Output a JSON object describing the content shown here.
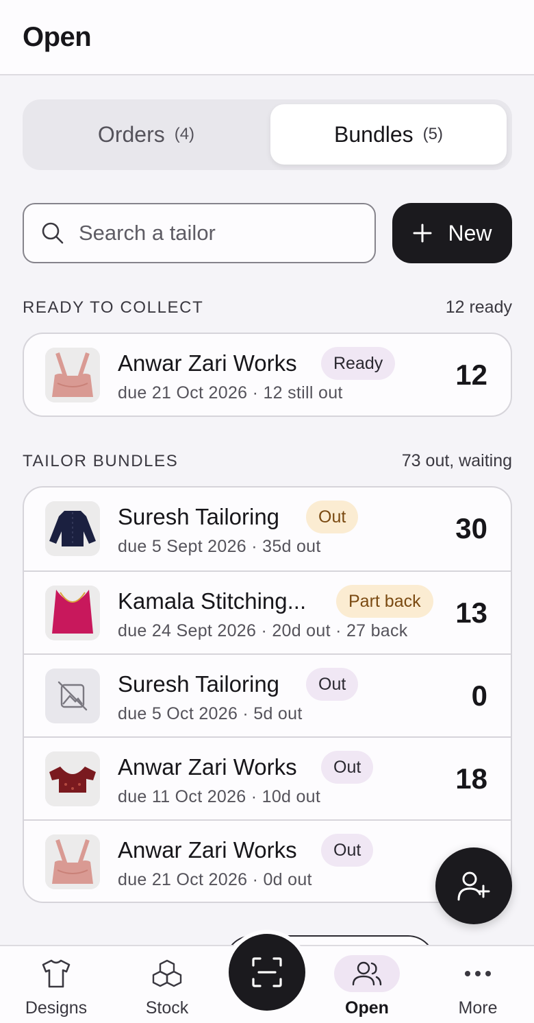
{
  "header": {
    "title": "Open"
  },
  "segmented": {
    "orders_label": "Orders",
    "orders_count": "(4)",
    "bundles_label": "Bundles",
    "bundles_count": "(5)"
  },
  "search": {
    "placeholder": "Search a tailor",
    "value": ""
  },
  "new_button": {
    "label": "New"
  },
  "ready_section": {
    "title": "READY TO COLLECT",
    "meta": "12 ready"
  },
  "ready_items": [
    {
      "thumb": "pink-halter-blouse",
      "name": "Anwar Zari Works",
      "badge": "Ready",
      "sub": "due 21 Oct 2026 · 12 still out",
      "qty": "12"
    }
  ],
  "bundles_section": {
    "title": "TAILOR BUNDLES",
    "meta": "73 out, waiting"
  },
  "bundles": [
    {
      "thumb": "navy-blouse",
      "name": "Suresh Tailoring",
      "badge": "Out",
      "sub": "due 5 Sept 2026 · 35d out",
      "qty": "30"
    },
    {
      "thumb": "magenta-halter-blouse",
      "name": "Kamala Stitching...",
      "badge": "Part back",
      "sub": "due 24 Sept 2026 · 20d out · 27 back",
      "qty": "13"
    },
    {
      "thumb": "no-image",
      "name": "Suresh Tailoring",
      "badge": "Out",
      "sub": "due 5 Oct 2026 · 5d out",
      "qty": "0"
    },
    {
      "thumb": "maroon-blouse",
      "name": "Anwar Zari Works",
      "badge": "Out",
      "sub": "due 11 Oct 2026 · 10d out",
      "qty": "18"
    },
    {
      "thumb": "pink-halter-blouse",
      "name": "Anwar Zari Works",
      "badge": "Out",
      "sub": "due 21 Oct 2026 · 0d out",
      "qty": ""
    }
  ],
  "fab": {
    "icon": "add-user-icon"
  },
  "nav": {
    "designs": "Designs",
    "stock": "Stock",
    "scan_icon": "scan-icon",
    "open": "Open",
    "more": "More"
  },
  "colors": {
    "accent_dark": "#1b1a1e",
    "badge_lilac": "#f0e7f4",
    "badge_amber": "#fbecd2",
    "background": "#f5f4f8"
  }
}
